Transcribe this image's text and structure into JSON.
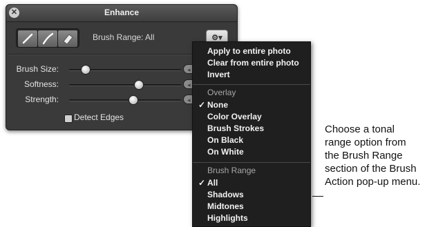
{
  "window": {
    "title": "Enhance"
  },
  "toolbar": {
    "brush_range_label": "Brush Range: All",
    "gear_icon_label": "⚙▾"
  },
  "sliders": [
    {
      "label": "Brush Size:",
      "value": 0.14
    },
    {
      "label": "Softness:",
      "value": 0.62
    },
    {
      "label": "Strength:",
      "value": 0.57
    }
  ],
  "checkbox": {
    "label": "Detect Edges",
    "checked": false
  },
  "menu": {
    "actions": [
      "Apply to entire photo",
      "Clear from entire photo",
      "Invert"
    ],
    "overlay_header": "Overlay",
    "overlay_items": [
      "None",
      "Color Overlay",
      "Brush Strokes",
      "On Black",
      "On White"
    ],
    "overlay_checked": "None",
    "range_header": "Brush Range",
    "range_items": [
      "All",
      "Shadows",
      "Midtones",
      "Highlights"
    ],
    "range_checked": "All",
    "checkmark": "✓"
  },
  "callout": {
    "lines": [
      "Choose a tonal",
      "range option from",
      "the Brush Range",
      "section of the Brush",
      "Action pop-up menu."
    ]
  },
  "colors": {
    "hud_bg": "#3a3a3a",
    "menu_bg": "#1f1f1f"
  }
}
